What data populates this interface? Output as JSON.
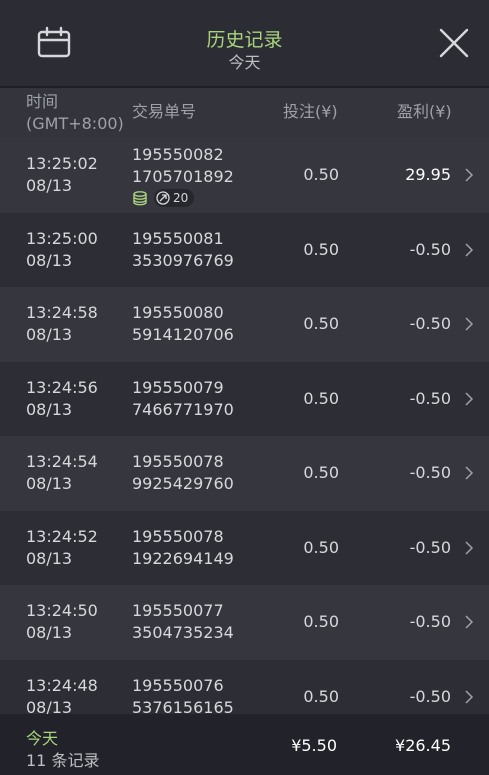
{
  "header": {
    "title": "历史记录",
    "subtitle": "今天"
  },
  "columns": {
    "time_line1": "时间",
    "time_line2": "(GMT+8:00)",
    "id": "交易单号",
    "bet": "投注(¥)",
    "profit": "盈利(¥)"
  },
  "rows": [
    {
      "time": "13:25:02",
      "date": "08/13",
      "id1": "195550082",
      "id2": "1705701892",
      "bet": "0.50",
      "profit": "29.95",
      "badge": "20"
    },
    {
      "time": "13:25:00",
      "date": "08/13",
      "id1": "195550081",
      "id2": "3530976769",
      "bet": "0.50",
      "profit": "-0.50"
    },
    {
      "time": "13:24:58",
      "date": "08/13",
      "id1": "195550080",
      "id2": "5914120706",
      "bet": "0.50",
      "profit": "-0.50"
    },
    {
      "time": "13:24:56",
      "date": "08/13",
      "id1": "195550079",
      "id2": "7466771970",
      "bet": "0.50",
      "profit": "-0.50"
    },
    {
      "time": "13:24:54",
      "date": "08/13",
      "id1": "195550078",
      "id2": "9925429760",
      "bet": "0.50",
      "profit": "-0.50"
    },
    {
      "time": "13:24:52",
      "date": "08/13",
      "id1": "195550078",
      "id2": "1922694149",
      "bet": "0.50",
      "profit": "-0.50"
    },
    {
      "time": "13:24:50",
      "date": "08/13",
      "id1": "195550077",
      "id2": "3504735234",
      "bet": "0.50",
      "profit": "-0.50"
    },
    {
      "time": "13:24:48",
      "date": "08/13",
      "id1": "195550076",
      "id2": "5376156165",
      "bet": "0.50",
      "profit": "-0.50"
    }
  ],
  "footer": {
    "today": "今天",
    "count": "11 条记录",
    "bet_total": "¥5.50",
    "profit_total": "¥26.45"
  },
  "colors": {
    "accent": "#a9d47d",
    "bg": "#2b2c33"
  },
  "icons": {
    "calendar": "calendar-icon",
    "close": "close-icon",
    "chevron": "chevron-right-icon",
    "coins": "coin-stack-icon",
    "multiplier": "multiplier-icon"
  }
}
